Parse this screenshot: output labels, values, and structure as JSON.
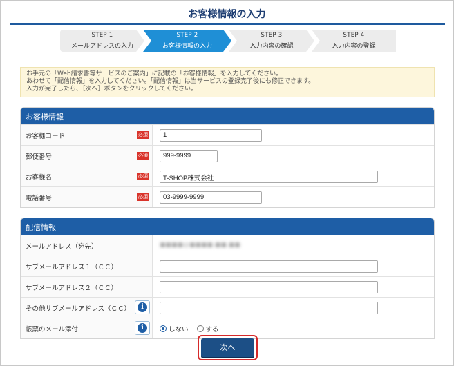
{
  "page": {
    "title": "お客様情報の入力"
  },
  "steps": [
    {
      "num": "STEP 1",
      "label": "メールアドレスの入力",
      "active": false
    },
    {
      "num": "STEP 2",
      "label": "お客様情報の入力",
      "active": true
    },
    {
      "num": "STEP 3",
      "label": "入力内容の確認",
      "active": false
    },
    {
      "num": "STEP 4",
      "label": "入力内容の登録",
      "active": false
    }
  ],
  "notice": {
    "lines": [
      "お手元の「Web請求書等サービスのご案内」に記載の「お客様情報」を入力してください。",
      "あわせて「配信情報」を入力してください。「配信情報」は当サービスの登録完了後にも修正できます。",
      "入力が完了したら、［次へ］ボタンをクリックしてください。"
    ]
  },
  "customer": {
    "header": "お客様情報",
    "required_label": "必須",
    "rows": [
      {
        "label": "お客様コード",
        "value": "1"
      },
      {
        "label": "郵便番号",
        "value": "999-9999"
      },
      {
        "label": "お客様名",
        "value": "T-SHOP株式会社"
      },
      {
        "label": "電話番号",
        "value": "03-9999-9999"
      }
    ]
  },
  "delivery": {
    "header": "配信情報",
    "email_label": "メールアドレス（宛先）",
    "email_value": "■■■■@■■■■.■■.■■",
    "sub1_label": "サブメールアドレス１（ＣＣ）",
    "sub1_value": "",
    "sub2_label": "サブメールアドレス２（ＣＣ）",
    "sub2_value": "",
    "other_label": "その他サブメールアドレス（ＣＣ）",
    "other_value": "",
    "attach_label": "帳票のメール添付",
    "attach_options": [
      "しない",
      "する"
    ],
    "attach_selected": "しない"
  },
  "buttons": {
    "next": "次へ"
  },
  "colors": {
    "brand": "#1e5ea6",
    "accent": "#1f8fd6",
    "required": "#d9342b",
    "highlight": "#d62a2a"
  },
  "icons": {
    "info": "info-icon"
  }
}
